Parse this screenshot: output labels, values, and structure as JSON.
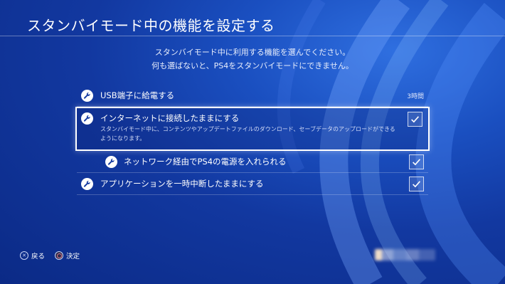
{
  "header": {
    "title": "スタンバイモード中の機能を設定する"
  },
  "description": {
    "line1": "スタンバイモード中に利用する機能を選んでください。",
    "line2": "何も選ばないと、PS4をスタンバイモードにできません。"
  },
  "options": [
    {
      "label": "USB端子に給電する",
      "value": "3時間",
      "icon": "wrench-icon"
    },
    {
      "label": "インターネットに接続したままにする",
      "description": "スタンバイモード中に、コンテンツやアップデートファイルのダウンロード、セーブデータのアップロードができるようになります。",
      "checked": true,
      "focused": true,
      "icon": "wrench-icon"
    },
    {
      "label": "ネットワーク経由でPS4の電源を入れられる",
      "checked": true,
      "indented": true,
      "icon": "wrench-icon"
    },
    {
      "label": "アプリケーションを一時中断したままにする",
      "checked": true,
      "icon": "wrench-icon"
    }
  ],
  "footer": {
    "back_label": "戻る",
    "back_icon": "cross-button-icon",
    "confirm_label": "決定",
    "confirm_icon": "circle-button-icon"
  },
  "colors": {
    "background": "#1238a0",
    "accent": "#ffffff"
  }
}
